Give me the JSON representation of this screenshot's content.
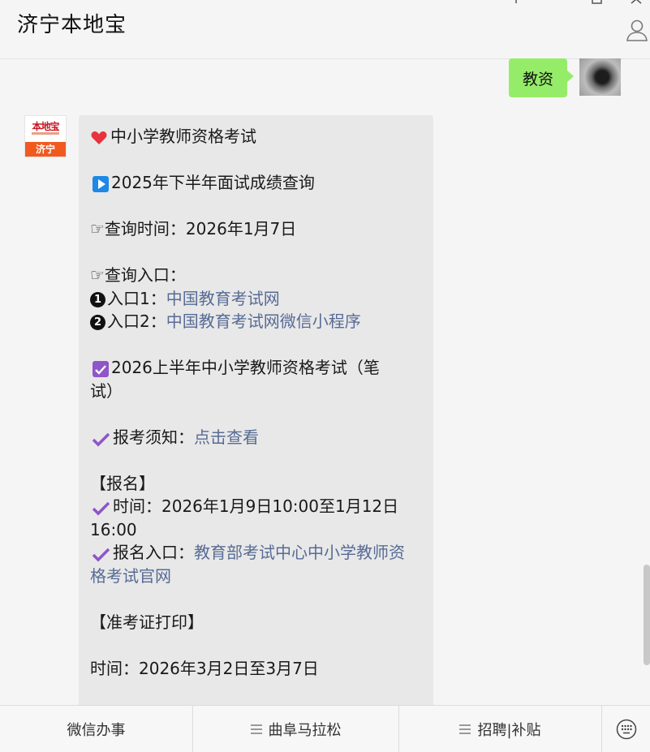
{
  "header": {
    "title": "济宁本地宝"
  },
  "icons": {
    "pin": "pin-icon",
    "maximize": "maximize-icon",
    "close": "close-icon",
    "profile": "user-profile-icon"
  },
  "messages": {
    "sent": {
      "text": "教资",
      "bubble_color": "#95ec69"
    },
    "bot": {
      "logo_text": "本地宝",
      "logo_city": "济宁",
      "lines": {
        "l1": "中小学教师资格考试",
        "l2": "2025年下半年面试成绩查询",
        "l3": "☞查询时间：2026年1月7日",
        "l4": "☞查询入口：",
        "l5_prefix": "入口1：",
        "l5_link": "中国教育考试网",
        "l6_prefix": "入口2：",
        "l6_link": "中国教育考试网微信小程序",
        "l7": "2026上半年中小学教师资格考试（笔",
        "l8": "试）",
        "l9_prefix": "报考须知：",
        "l9_link": "点击查看",
        "l10": "【报名】",
        "l11": "时间：2026年1月9日10:00至1月12日",
        "l12": "16:00",
        "l13_prefix": "报名入口：",
        "l13_link": "教育部考试中心中小学教师资",
        "l14_link": "格考试官网",
        "l15": "【准考证打印】",
        "l16": "时间：2026年3月2日至3月7日"
      },
      "num1": "1",
      "num2": "2"
    }
  },
  "bottom_menu": {
    "tab1": "微信办事",
    "tab2": "曲阜马拉松",
    "tab3": "招聘|补贴",
    "keyboard_icon": "keyboard-icon"
  },
  "colors": {
    "link": "#576b95",
    "accent_check": "#8e56c8",
    "play_blue": "#1e88e5"
  }
}
